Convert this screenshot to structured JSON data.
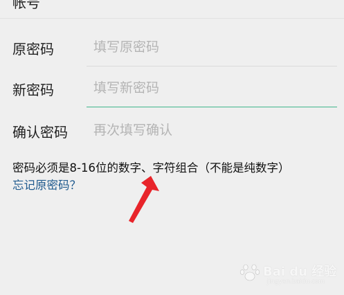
{
  "form": {
    "old_password": {
      "label": "原密码",
      "placeholder": "填写原密码",
      "value": ""
    },
    "new_password": {
      "label": "新密码",
      "placeholder": "填写新密码",
      "value": ""
    },
    "confirm_password": {
      "label": "确认密码",
      "placeholder": "再次填写确认",
      "value": ""
    },
    "hint": "密码必须是8-16位的数字、字符组合（不能是纯数字）",
    "forgot_link": "忘记原密码？"
  },
  "colors": {
    "background": "#efefef",
    "active_underline": "#3fb58a",
    "link": "#1f5a8e",
    "annotation_arrow": "#e8242a"
  },
  "annotation": {
    "icon": "red-arrow-icon"
  },
  "watermark": {
    "text": "Bai du 经验",
    "subtext": "jingyan.baidu.com"
  }
}
